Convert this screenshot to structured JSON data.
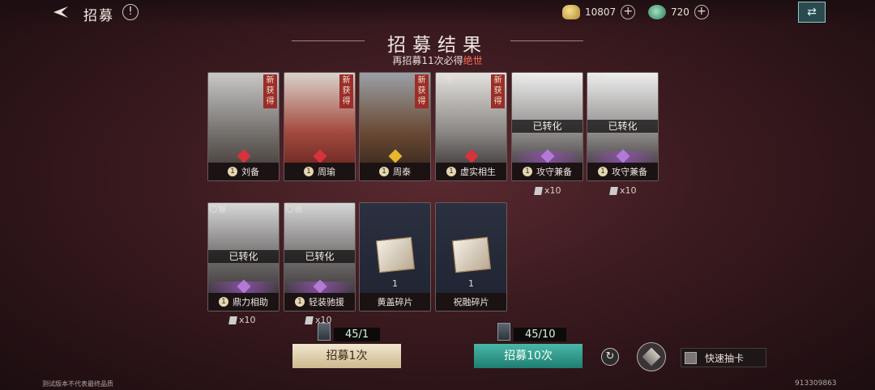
{
  "header": {
    "page_label": "招募",
    "info_mark": "!",
    "currencies": [
      {
        "icon": "gold-ingot-icon",
        "value": "10807"
      },
      {
        "icon": "jade-icon",
        "value": "720"
      }
    ],
    "plus": "+",
    "corner_button_icon": "exchange-icon"
  },
  "title": "招募结果",
  "subtitle": {
    "prefix": "再招募11次必得",
    "highlight": "绝世"
  },
  "cards": [
    {
      "name": "刘备",
      "level": "1",
      "new_tag": "新获得",
      "corner": "",
      "converted": "",
      "extra": "",
      "gem_color": "#d8323a",
      "type": "hero"
    },
    {
      "name": "周瑜",
      "level": "1",
      "new_tag": "新获得",
      "corner": "",
      "converted": "",
      "extra": "",
      "gem_color": "#d8323a",
      "type": "hero"
    },
    {
      "name": "周泰",
      "level": "1",
      "new_tag": "新获得",
      "corner": "",
      "converted": "",
      "extra": "",
      "gem_color": "#e6b62e",
      "type": "hero"
    },
    {
      "name": "虚实相生",
      "level": "1",
      "new_tag": "新获得",
      "corner": "统",
      "converted": "",
      "extra": "",
      "gem_color": "#d8323a",
      "type": "skill"
    },
    {
      "name": "攻守兼备",
      "level": "1",
      "new_tag": "",
      "corner": "武",
      "converted": "已转化",
      "extra": "x10",
      "gem_color": "#b27ad6",
      "type": "skill"
    },
    {
      "name": "攻守兼备",
      "level": "1",
      "new_tag": "",
      "corner": "武",
      "converted": "已转化",
      "extra": "x10",
      "gem_color": "#b27ad6",
      "type": "skill"
    },
    {
      "name": "鼎力相助",
      "level": "1",
      "new_tag": "",
      "corner": "魅",
      "converted": "已转化",
      "extra": "x10",
      "gem_color": "#b27ad6",
      "type": "skill"
    },
    {
      "name": "轻装驰援",
      "level": "1",
      "new_tag": "",
      "corner": "统",
      "converted": "已转化",
      "extra": "x10",
      "gem_color": "#b27ad6",
      "type": "skill"
    },
    {
      "name": "黄盖碎片",
      "quantity": "1",
      "type": "shard"
    },
    {
      "name": "祝融碎片",
      "quantity": "1",
      "type": "shard"
    }
  ],
  "counters": [
    {
      "value": "45/1"
    },
    {
      "value": "45/10"
    }
  ],
  "buttons": {
    "recruit_once": "招募1次",
    "recruit_ten": "招募10次",
    "quick_draw": "快速抽卡"
  },
  "footer": {
    "disclaimer": "测试版本不代表最终品质",
    "uid": "913309863"
  }
}
